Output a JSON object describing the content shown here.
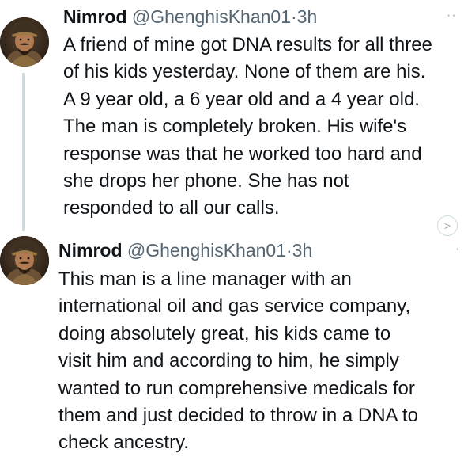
{
  "tweets": [
    {
      "display_name": "Nimrod",
      "handle": "@GhenghisKhan01",
      "separator": "·",
      "time": "3h",
      "more_icon": "more-dots-icon",
      "text": "A friend of mine got DNA results for all three\nof his kids yesterday. None of them are his.\nA 9 year old, a 6 year old and a 4 year old.\nThe man is completely broken. His wife's\nresponse was that he worked too hard and\nshe drops her phone. She has not\nresponded to all our calls."
    },
    {
      "display_name": "Nimrod",
      "handle": "@GhenghisKhan01",
      "separator": "·",
      "time": "3h",
      "more_icon": "more-dots-icon",
      "text": "This man is a line manager with an\ninternational oil and gas service company,\ndoing absolutely great, his kids came to\nvisit him and according to him, he simply\nwanted to run comprehensive medicals for\nthem and just decided to throw in a DNA to\ncheck ancestry."
    }
  ],
  "colors": {
    "text": "#0f1419",
    "secondary": "#536471",
    "thread_line": "#cfd9de"
  }
}
